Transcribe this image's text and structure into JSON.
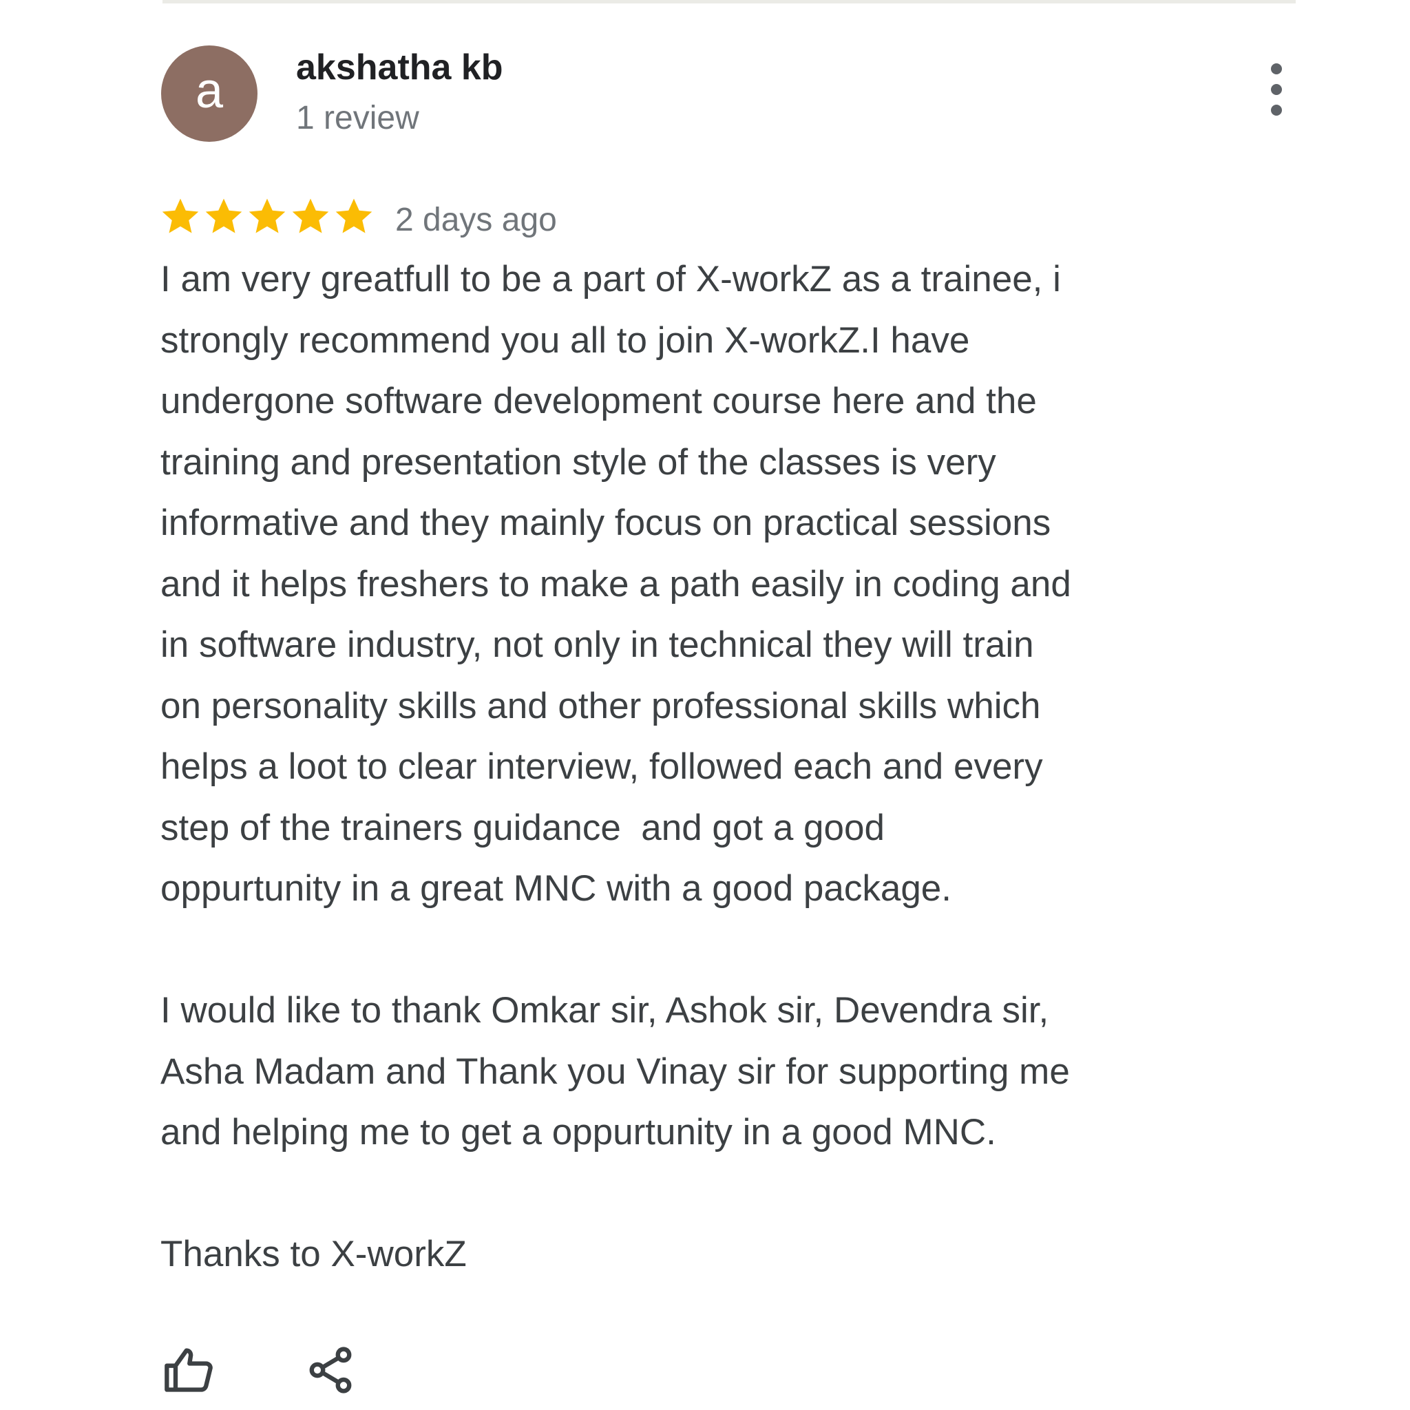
{
  "review": {
    "author": {
      "avatar_letter": "a",
      "avatar_color": "#8d6e63",
      "name": "akshatha kb",
      "review_count": "1 review"
    },
    "more_options_icon": "more-vertical-icon",
    "rating": 5,
    "rating_max": 5,
    "star_color": "#fbbc04",
    "date": "2 days ago",
    "body_lines": [
      "I am very greatfull to be a part of X-workZ as a trainee, i",
      "strongly recommend you all to join X-workZ.I have",
      "undergone software development course here and the",
      "training and presentation style of the classes is very",
      "informative and they mainly focus on practical sessions",
      "and it helps freshers to make a path easily in coding and",
      "in software industry, not only in technical they will train",
      "on personality skills and other professional skills which",
      "helps a loot to clear interview, followed each and every",
      "step of the trainers guidance  and got a good",
      "oppurtunity in a great MNC with a good package."
    ],
    "thanks_lines": [
      "I would like to thank Omkar sir, Ashok sir, Devendra sir,",
      "Asha Madam and Thank you Vinay sir for supporting me",
      "and helping me to get a oppurtunity in a good MNC."
    ],
    "closing": "Thanks to X-workZ",
    "actions": {
      "like_icon": "thumbs-up-icon",
      "share_icon": "share-icon"
    }
  }
}
